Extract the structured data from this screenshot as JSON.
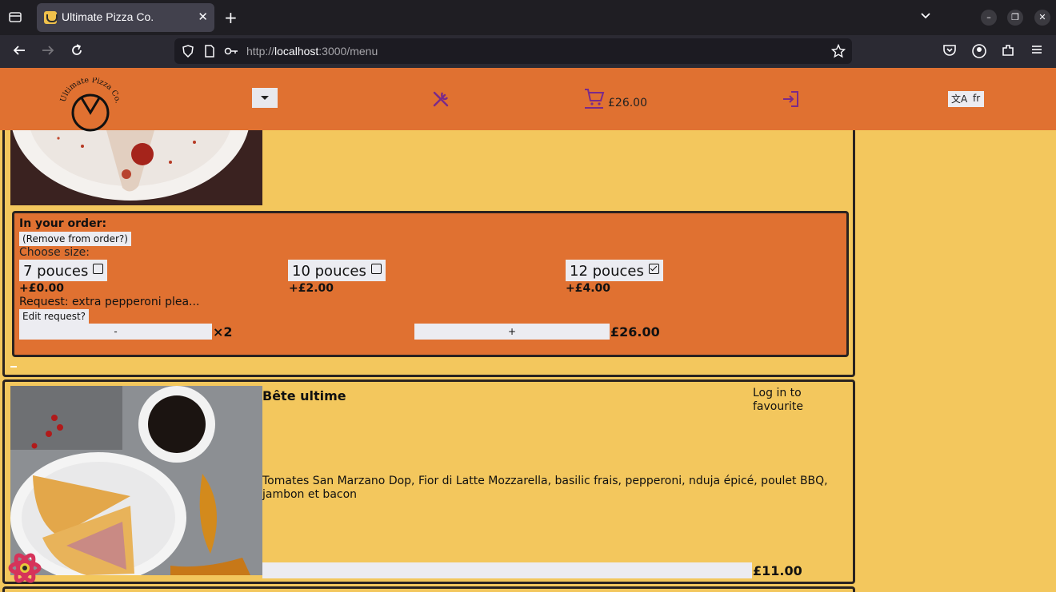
{
  "browser": {
    "tab_title": "Ultimate Pizza Co.",
    "url_scheme": "http://",
    "url_host": "localhost",
    "url_path": ":3000/menu"
  },
  "header": {
    "logo_text": "Ultimate Pizza Co.",
    "cart_total": "£26.00",
    "language": "fr",
    "accent_color": "#e07131",
    "background_color": "#f3c75d"
  },
  "order_item": {
    "in_order_label": "In your order:",
    "remove_label": "(Remove from order?)",
    "choose_size_label": "Choose size:",
    "sizes": [
      {
        "label": "7 pouces",
        "price": "+£0.00",
        "checked": false
      },
      {
        "label": "10 pouces",
        "price": "+£2.00",
        "checked": false
      },
      {
        "label": "12 pouces",
        "price": "+£4.00",
        "checked": true
      }
    ],
    "request_text": "Request: extra pepperoni plea...",
    "edit_request_label": "Edit request?",
    "minus_label": "-",
    "quantity": "×2",
    "plus_label": "+",
    "line_total": "£26.00"
  },
  "pizza_card": {
    "name": "Bête ultime",
    "favourite_text": "Log in to favourite",
    "description": "Tomates San Marzano Dop, Fior di Latte Mozzarella, basilic frais, pepperoni, nduja épicé, poulet BBQ, jambon et bacon",
    "add_label": "",
    "price": "£11.00"
  }
}
